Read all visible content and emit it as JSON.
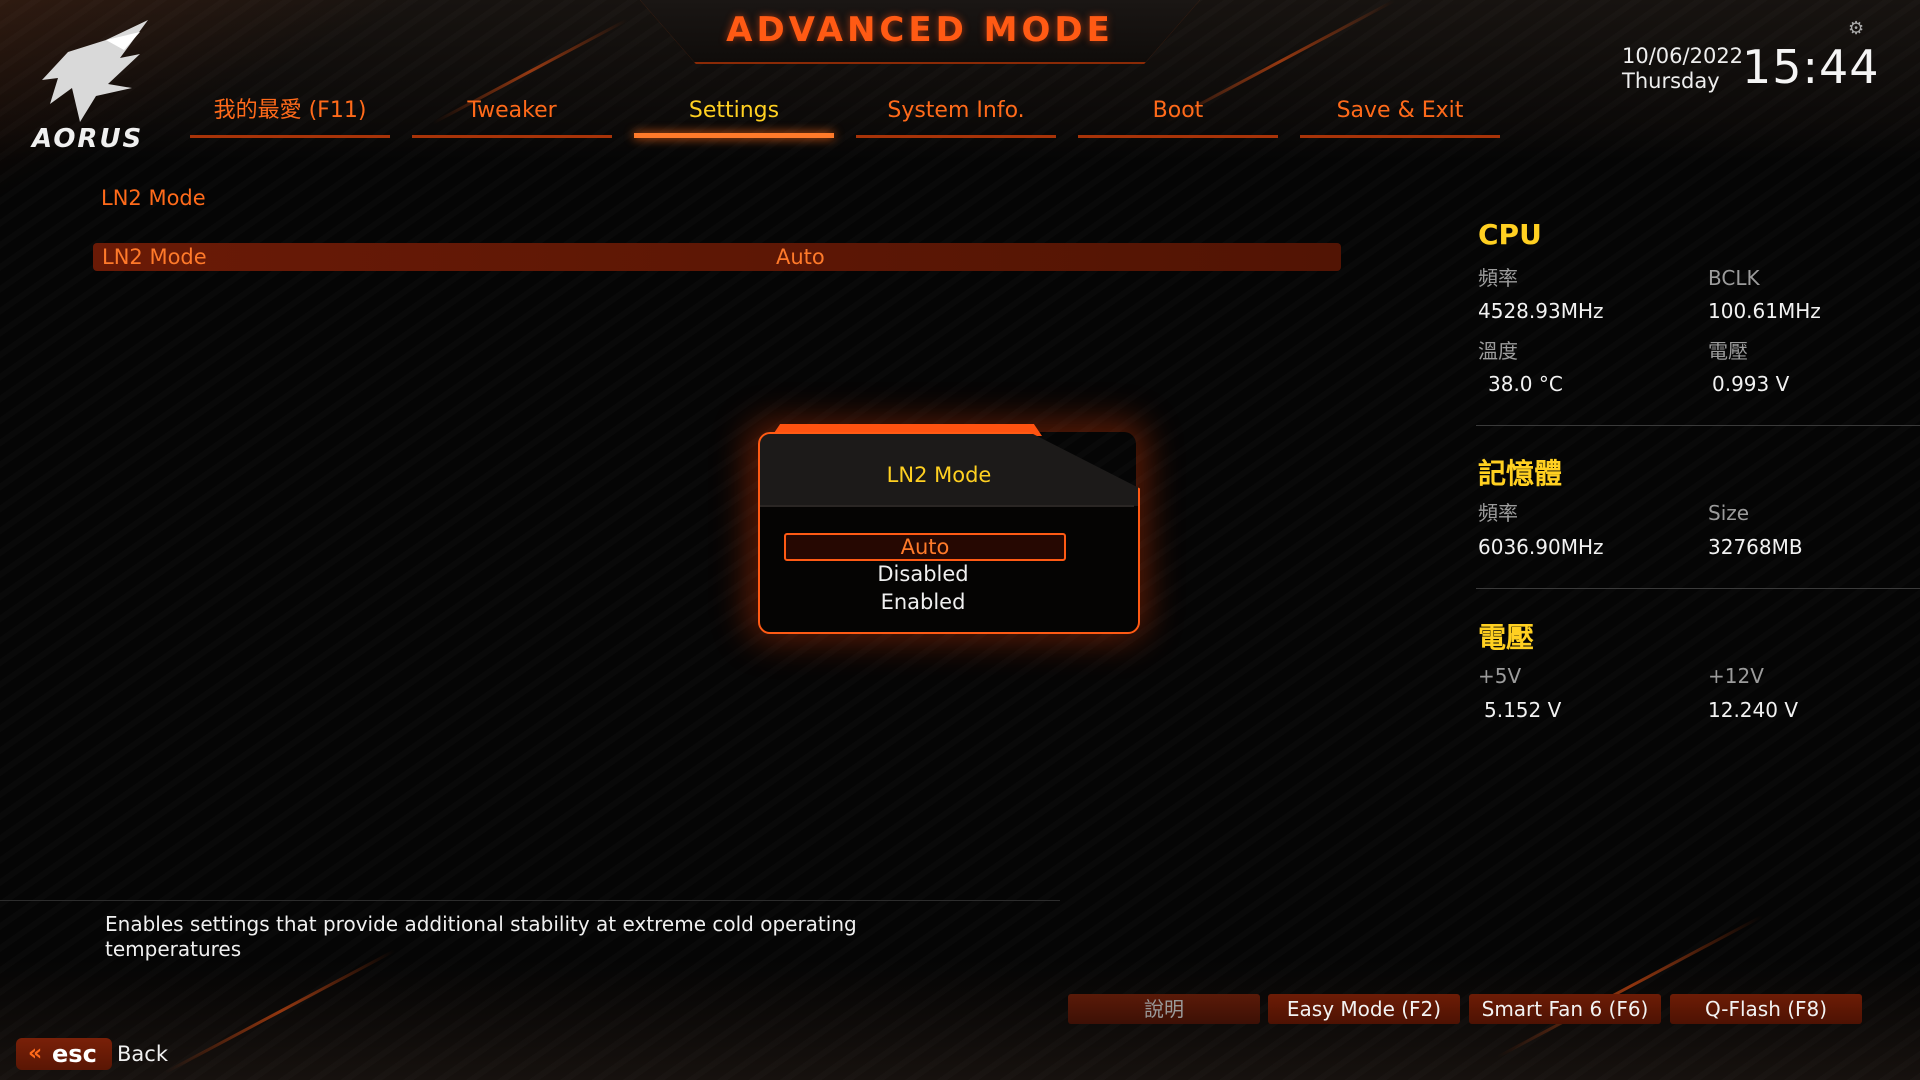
{
  "header": {
    "title": "ADVANCED MODE",
    "brand": "AORUS",
    "date": "10/06/2022",
    "weekday": "Thursday",
    "time": "15:44",
    "icons": {
      "logo": "eagle-logo-icon",
      "settings": "gear-icon"
    }
  },
  "tabs": [
    {
      "label": "我的最愛 (F11)"
    },
    {
      "label": "Tweaker"
    },
    {
      "label": "Settings",
      "active": true
    },
    {
      "label": "System Info."
    },
    {
      "label": "Boot"
    },
    {
      "label": "Save & Exit"
    }
  ],
  "content": {
    "section_title": "LN2 Mode",
    "selected_row": {
      "label": "LN2 Mode",
      "value": "Auto"
    }
  },
  "popup": {
    "title": "LN2 Mode",
    "options": [
      "Auto",
      "Disabled",
      "Enabled"
    ],
    "selected": "Auto"
  },
  "sidebar": {
    "cpu": {
      "heading": "CPU",
      "freq_label": "頻率",
      "freq_value": "4528.93MHz",
      "bclk_label": "BCLK",
      "bclk_value": "100.61MHz",
      "temp_label": "溫度",
      "temp_value": "38.0 °C",
      "volt_label": "電壓",
      "volt_value": "0.993 V"
    },
    "memory": {
      "heading": "記憶體",
      "freq_label": "頻率",
      "freq_value": "6036.90MHz",
      "size_label": "Size",
      "size_value": "32768MB"
    },
    "voltage": {
      "heading": "電壓",
      "v5_label": "+5V",
      "v5_value": "5.152 V",
      "v12_label": "+12V",
      "v12_value": "12.240 V"
    }
  },
  "help": {
    "text": "Enables settings that provide additional stability at extreme cold operating temperatures"
  },
  "footer": {
    "buttons": [
      "說明",
      "Easy Mode (F2)",
      "Smart Fan 6 (F6)",
      "Q-Flash (F8)"
    ],
    "esc_label": "esc",
    "back_label": "Back"
  },
  "colors": {
    "accent": "#ff5a14",
    "highlight": "#ffd021",
    "selection": "#6a1a06"
  }
}
